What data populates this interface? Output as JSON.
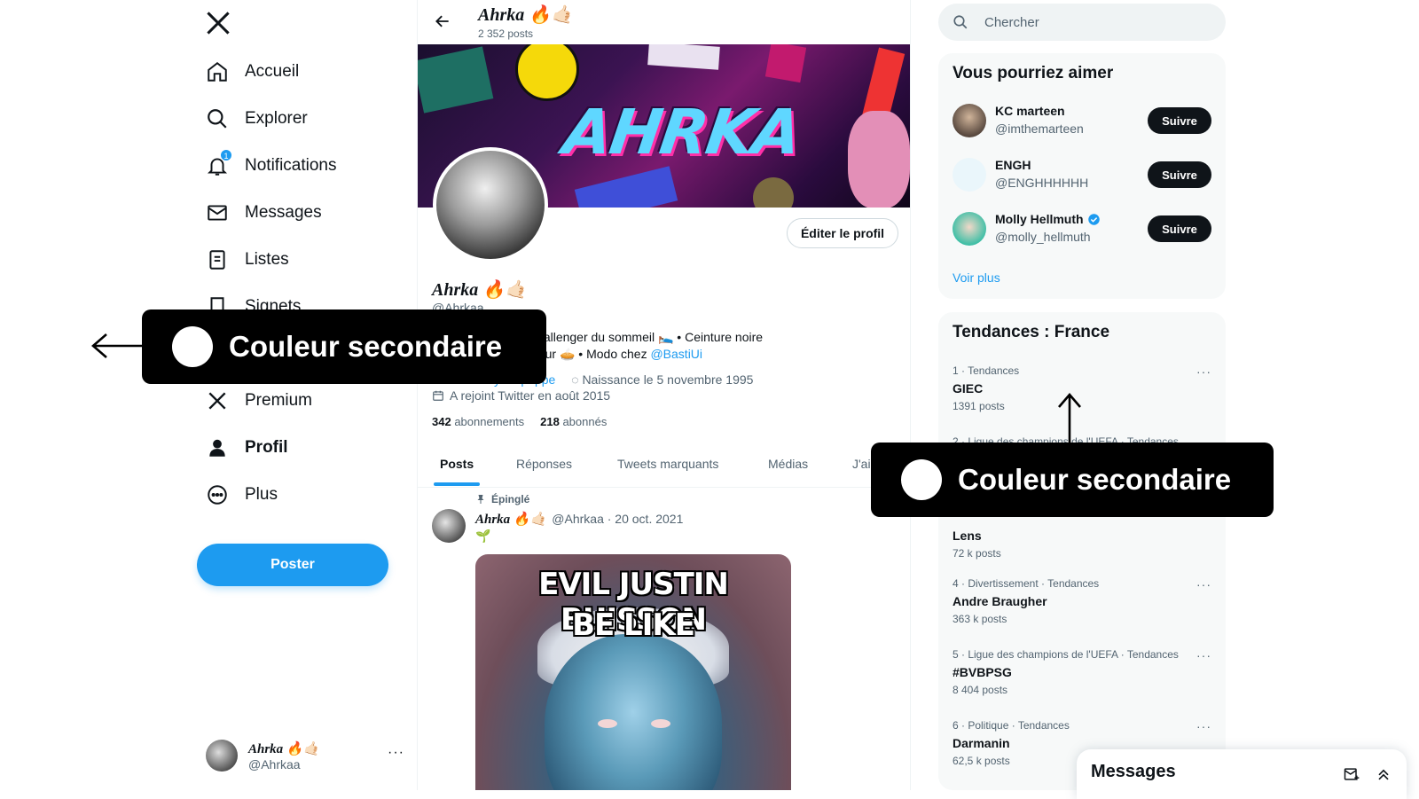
{
  "nav": {
    "items": [
      {
        "label": "Accueil",
        "icon": "home-icon"
      },
      {
        "label": "Explorer",
        "icon": "search-icon"
      },
      {
        "label": "Notifications",
        "icon": "bell-icon",
        "badge": "1"
      },
      {
        "label": "Messages",
        "icon": "envelope-icon"
      },
      {
        "label": "Listes",
        "icon": "list-icon"
      },
      {
        "label": "Signets",
        "icon": "bookmark-icon"
      },
      {
        "label": "Premium",
        "icon": "x-icon"
      },
      {
        "label": "Profil",
        "icon": "person-icon"
      },
      {
        "label": "Plus",
        "icon": "more-circle-icon"
      }
    ],
    "post_button": "Poster",
    "account": {
      "name": "Ahrka 🔥🤙🏻",
      "handle": "@Ahrkaa",
      "more": "···"
    }
  },
  "profile": {
    "top_name": "Ahrka 🔥🤙🏻",
    "top_posts": "2 352 posts",
    "banner_text": "AHRKA",
    "edit_button": "Éditer le profil",
    "name": "Ahrka 🔥🤙🏻",
    "handle": "@Ahrkaa",
    "bio_line1": "UI Designer ✍️ • Challenger du sommeil 🛌 • Ceinture noire",
    "bio_line2_text": "de créateur de couleur 🥧 • Modo chez ",
    "bio_line2_link": "@BastiUi",
    "website": "bento.me/dylan-poppe",
    "birth": "Naissance le 5 novembre 1995",
    "joined": "A rejoint Twitter en août 2015",
    "following_count": "342",
    "following_label": "abonnements",
    "followers_count": "218",
    "followers_label": "abonnés"
  },
  "tabs": [
    "Posts",
    "Réponses",
    "Tweets marquants",
    "Médias",
    "J'aime"
  ],
  "tweet": {
    "pinned_label": "Épinglé",
    "name": "Ahrka 🔥🤙🏻",
    "handle_date": "@Ahrkaa · 20 oct. 2021",
    "text": "🌱",
    "more": "···",
    "meme_line1": "EVIL JUSTIN BUISSON",
    "meme_line2": "BE LIKE"
  },
  "search": {
    "placeholder": "Chercher"
  },
  "suggestions": {
    "title": "Vous pourriez aimer",
    "users": [
      {
        "name": "KC marteen",
        "handle": "@imthemarteen",
        "button": "Suivre",
        "verified": false
      },
      {
        "name": "ENGH",
        "handle": "@ENGHHHHHH",
        "button": "Suivre",
        "verified": false
      },
      {
        "name": "Molly Hellmuth",
        "handle": "@molly_hellmuth",
        "button": "Suivre",
        "verified": true
      }
    ],
    "more_link": "Voir plus"
  },
  "trends": {
    "title": "Tendances : France",
    "items": [
      {
        "meta": "1 · Tendances",
        "title": "GIEC",
        "count": "1391 posts"
      },
      {
        "meta": "2 · Ligue des champions de l'UEFA · Tendances",
        "title": "",
        "count": ""
      },
      {
        "meta": "",
        "title": "Lens",
        "count": "72 k posts"
      },
      {
        "meta": "4 · Divertissement · Tendances",
        "title": "Andre Braugher",
        "count": "363 k posts"
      },
      {
        "meta": "5 · Ligue des champions de l'UEFA · Tendances",
        "title": "#BVBPSG",
        "count": "8 404 posts"
      },
      {
        "meta": "6 · Politique · Tendances",
        "title": "Darmanin",
        "count": "62,5 k posts"
      }
    ],
    "more": "···"
  },
  "messages_drawer": {
    "title": "Messages"
  },
  "annotations": [
    {
      "label": "Couleur secondaire"
    },
    {
      "label": "Couleur secondaire"
    }
  ],
  "colors": {
    "accent": "#1d9bf0",
    "text": "#0f1419",
    "muted": "#536471",
    "annotation_bg": "#000000"
  }
}
